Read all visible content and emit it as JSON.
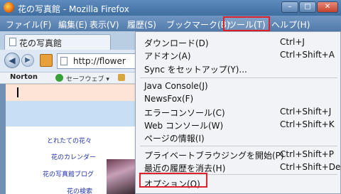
{
  "window": {
    "title": "花の写真館 - Mozilla Firefox",
    "min_symbol": "–",
    "max_symbol": "□",
    "close_symbol": "✕"
  },
  "menubar": {
    "file": "ファイル(F)",
    "edit": "編集(E)",
    "view": "表示(V)",
    "history": "履歴(S)",
    "bookmarks": "ブックマーク(B)",
    "tools": "ツール(T)",
    "help": "ヘルプ(H)"
  },
  "tab": {
    "label": "花の写真館"
  },
  "nav": {
    "back_symbol": "◀",
    "forward_symbol": "▶",
    "url": "http://flower"
  },
  "norton": {
    "label": "Norton",
    "safe_label": "セーフウェブ ▾"
  },
  "page": {
    "links": [
      "とれたての花々",
      "花のカレンダー",
      "花の写真館ブログ",
      "花の検索"
    ]
  },
  "tools_menu": {
    "items": [
      {
        "label": "ダウンロード(D)",
        "shortcut": "Ctrl+J"
      },
      {
        "label": "アドオン(A)",
        "shortcut": "Ctrl+Shift+A"
      },
      {
        "label": "Sync をセットアップ(Y)...",
        "shortcut": ""
      },
      {
        "label": "Java Console(J)",
        "shortcut": ""
      },
      {
        "label": "NewsFox(F)",
        "shortcut": ""
      },
      {
        "label": "エラーコンソール(C)",
        "shortcut": "Ctrl+Shift+J"
      },
      {
        "label": "Web コンソール(W)",
        "shortcut": "Ctrl+Shift+K"
      },
      {
        "label": "ページの情報(I)",
        "shortcut": ""
      },
      {
        "label": "プライベートブラウジングを開始(P)",
        "shortcut": "Ctrl+Shift+P"
      },
      {
        "label": "最近の履歴を消去(H)",
        "shortcut": "Ctrl+Shift+Del"
      },
      {
        "label": "オプション(O)",
        "shortcut": ""
      }
    ]
  },
  "highlight_color": "#e0202a"
}
